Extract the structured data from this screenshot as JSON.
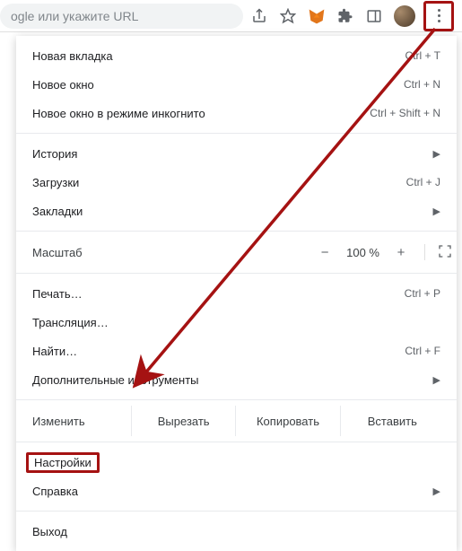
{
  "omnibox": {
    "placeholder": "ogle или укажите URL"
  },
  "menu": {
    "new_tab": {
      "label": "Новая вкладка",
      "shortcut": "Ctrl + T"
    },
    "new_window": {
      "label": "Новое окно",
      "shortcut": "Ctrl + N"
    },
    "incognito": {
      "label": "Новое окно в режиме инкогнито",
      "shortcut": "Ctrl + Shift + N"
    },
    "history": {
      "label": "История"
    },
    "downloads": {
      "label": "Загрузки",
      "shortcut": "Ctrl + J"
    },
    "bookmarks": {
      "label": "Закладки"
    },
    "zoom": {
      "label": "Масштаб",
      "value": "100 %"
    },
    "print": {
      "label": "Печать…",
      "shortcut": "Ctrl + P"
    },
    "cast": {
      "label": "Трансляция…"
    },
    "find": {
      "label": "Найти…",
      "shortcut": "Ctrl + F"
    },
    "more_tools": {
      "label": "Дополнительные инструменты"
    },
    "edit": {
      "label": "Изменить",
      "cut": "Вырезать",
      "copy": "Копировать",
      "paste": "Вставить"
    },
    "settings": {
      "label": "Настройки"
    },
    "help": {
      "label": "Справка"
    },
    "exit": {
      "label": "Выход"
    }
  }
}
